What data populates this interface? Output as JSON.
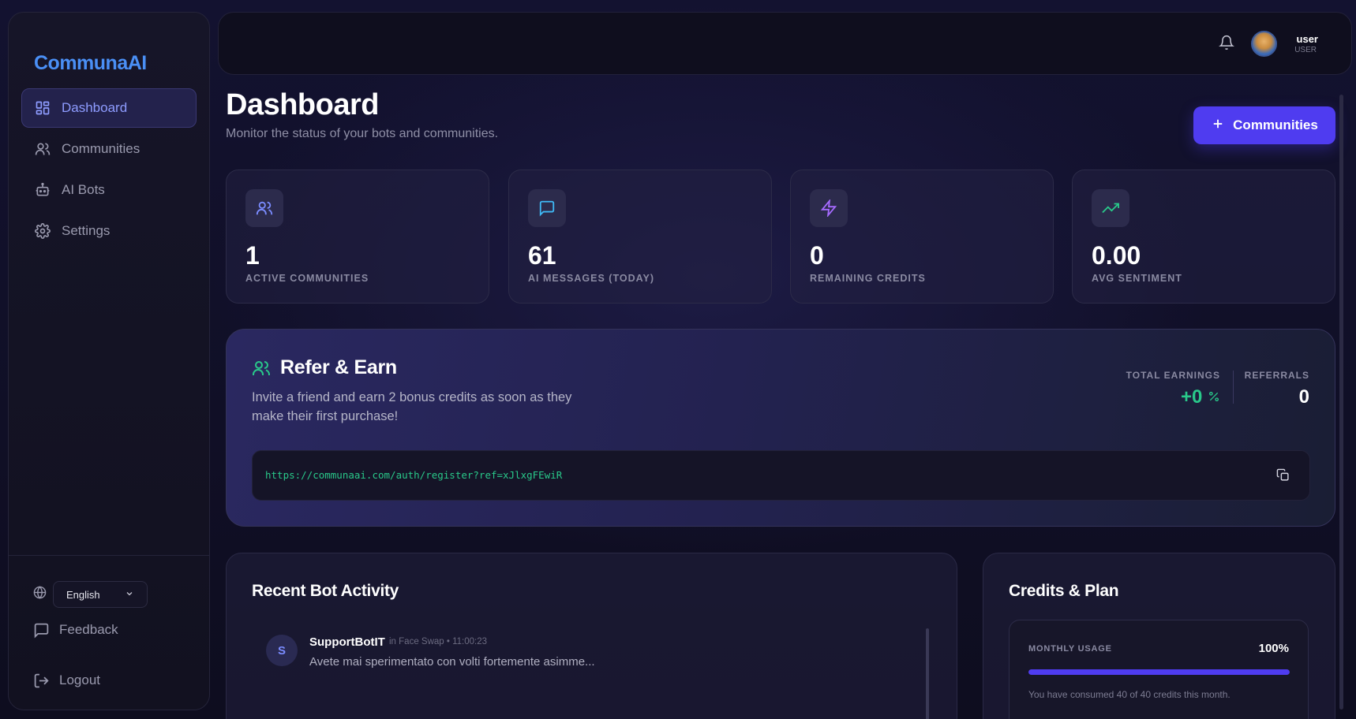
{
  "brand": {
    "logo": "CommunaAI"
  },
  "sidebar": {
    "items": [
      {
        "label": "Dashboard",
        "icon": "dashboard-grid-icon",
        "active": true
      },
      {
        "label": "Communities",
        "icon": "users-icon"
      },
      {
        "label": "AI Bots",
        "icon": "bot-icon"
      },
      {
        "label": "Settings",
        "icon": "gear-icon"
      }
    ],
    "language": "English",
    "feedback": "Feedback",
    "logout": "Logout"
  },
  "topbar": {
    "user_name": "user",
    "user_role": "USER"
  },
  "header": {
    "title": "Dashboard",
    "subtitle": "Monitor the status of your bots and communities.",
    "add_button": "Communities"
  },
  "stats": [
    {
      "value": "1",
      "label": "ACTIVE COMMUNITIES",
      "icon": "users-icon",
      "color": "#7b8cff"
    },
    {
      "value": "61",
      "label": "AI MESSAGES (TODAY)",
      "icon": "message-icon",
      "color": "#3fb8f5"
    },
    {
      "value": "0",
      "label": "REMAINING CREDITS",
      "icon": "lightning-icon",
      "color": "#a66bff"
    },
    {
      "value": "0.00",
      "label": "AVG SENTIMENT",
      "icon": "trending-up-icon",
      "color": "#29c98a"
    }
  ],
  "refer": {
    "title": "Refer & Earn",
    "description": "Invite a friend and earn 2 bonus credits as soon as they make their first purchase!",
    "earnings_label": "TOTAL EARNINGS",
    "earnings_value": "+0",
    "referrals_label": "REFERRALS",
    "referrals_value": "0",
    "link": "https://communaai.com/auth/register?ref=xJlxgFEwiR"
  },
  "activity": {
    "title": "Recent Bot Activity",
    "items": [
      {
        "initial": "S",
        "bot": "SupportBotIT",
        "meta": "in Face Swap  • 11:00:23",
        "message": "Avete mai sperimentato con volti fortemente asimme..."
      }
    ]
  },
  "credits": {
    "title": "Credits & Plan",
    "usage_label": "MONTHLY USAGE",
    "usage_percent": "100%",
    "usage_fraction": 1.0,
    "usage_note": "You have consumed 40 of 40 credits this month."
  },
  "colors": {
    "accent": "#4f3cf0",
    "success": "#29c98a",
    "brand": "#4a8ff5"
  }
}
